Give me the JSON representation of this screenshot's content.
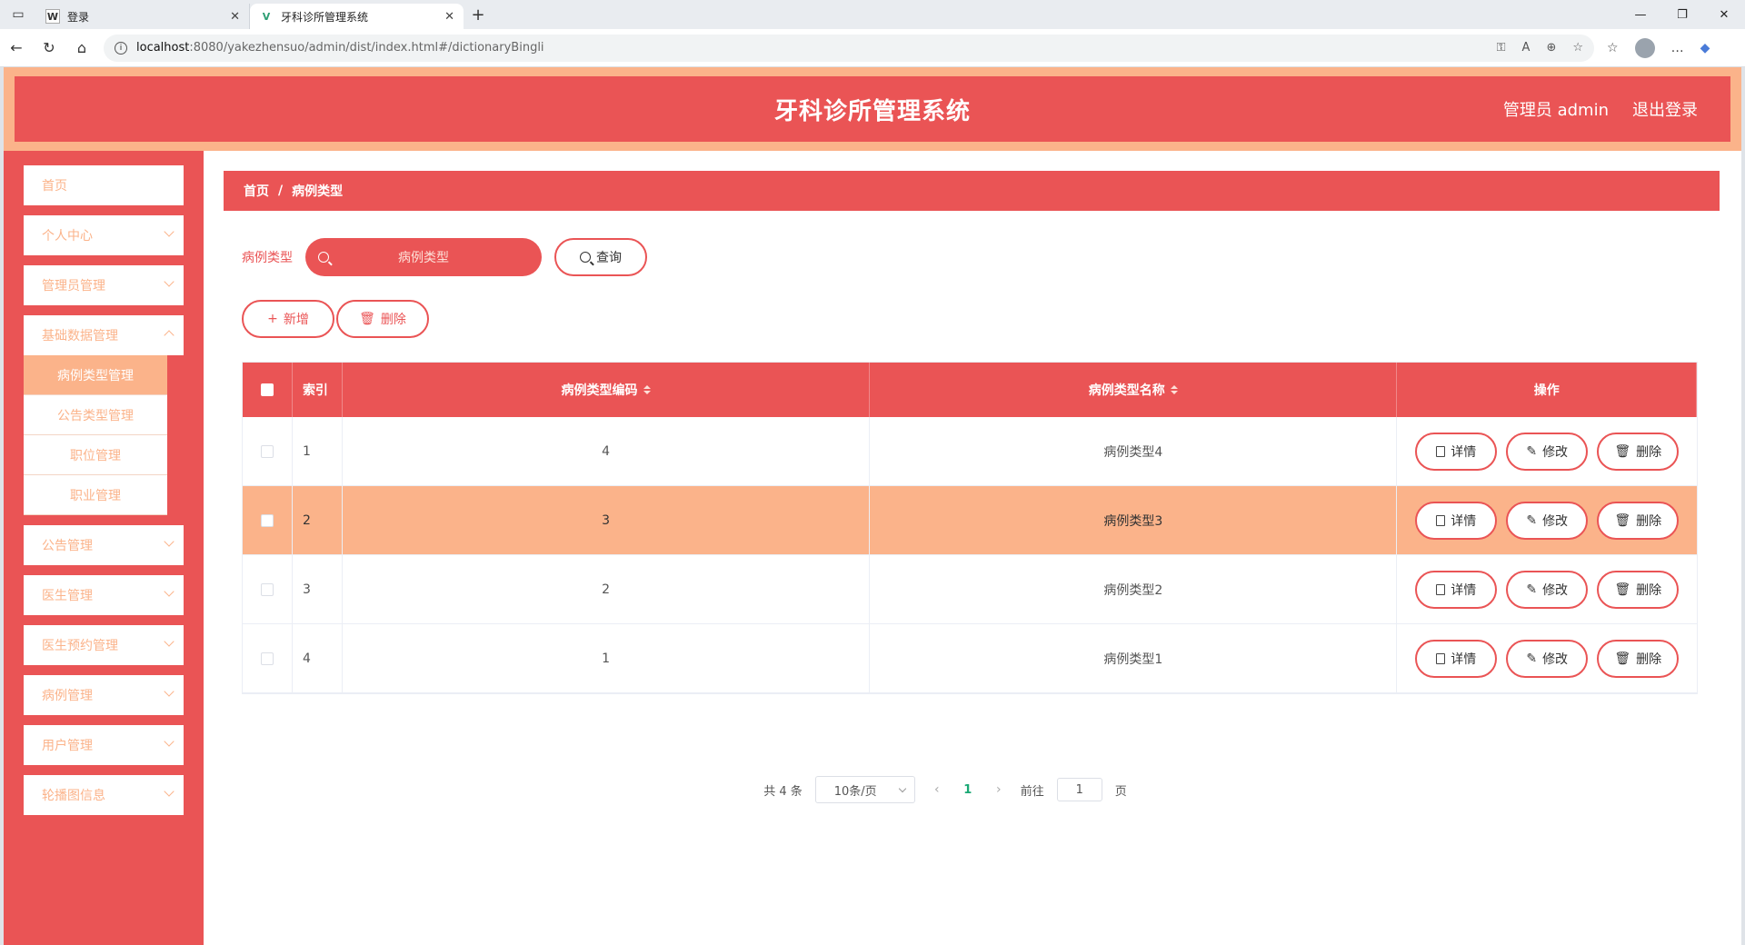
{
  "browser": {
    "tabs": [
      {
        "title": "登录",
        "favicon": "W"
      },
      {
        "title": "牙科诊所管理系统",
        "favicon": "V"
      }
    ],
    "url_host": "localhost",
    "url_rest": ":8080/yakezhensuo/admin/dist/index.html#/dictionaryBingli"
  },
  "header": {
    "title": "牙科诊所管理系统",
    "user": "管理员 admin",
    "logout": "退出登录"
  },
  "sidebar": {
    "items": [
      {
        "label": "首页",
        "has_children": false
      },
      {
        "label": "个人中心",
        "has_children": true
      },
      {
        "label": "管理员管理",
        "has_children": true
      },
      {
        "label": "基础数据管理",
        "has_children": true
      }
    ],
    "submenu": [
      {
        "label": "病例类型管理",
        "active": true
      },
      {
        "label": "公告类型管理",
        "active": false
      },
      {
        "label": "职位管理",
        "active": false
      },
      {
        "label": "职业管理",
        "active": false
      }
    ],
    "items_after": [
      {
        "label": "公告管理"
      },
      {
        "label": "医生管理"
      },
      {
        "label": "医生预约管理"
      },
      {
        "label": "病例管理"
      },
      {
        "label": "用户管理"
      },
      {
        "label": "轮播图信息"
      }
    ]
  },
  "breadcrumb": {
    "home": "首页",
    "sep": "/",
    "current": "病例类型"
  },
  "search": {
    "label": "病例类型",
    "placeholder": "病例类型",
    "button": "查询"
  },
  "actions": {
    "add": "新增",
    "delete": "删除"
  },
  "table": {
    "headers": {
      "index": "索引",
      "code": "病例类型编码",
      "name": "病例类型名称",
      "ops": "操作"
    },
    "rows": [
      {
        "index": "1",
        "code": "4",
        "name": "病例类型4",
        "highlight": false
      },
      {
        "index": "2",
        "code": "3",
        "name": "病例类型3",
        "highlight": true
      },
      {
        "index": "3",
        "code": "2",
        "name": "病例类型2",
        "highlight": false
      },
      {
        "index": "4",
        "code": "1",
        "name": "病例类型1",
        "highlight": false
      }
    ],
    "ops": {
      "detail": "详情",
      "edit": "修改",
      "delete": "删除"
    }
  },
  "pagination": {
    "total": "共 4 条",
    "page_size": "10条/页",
    "current": "1",
    "goto_label": "前往",
    "goto_value": "1",
    "page_suffix": "页"
  },
  "colors": {
    "primary": "#ea5455",
    "accent": "#fbb38a"
  }
}
